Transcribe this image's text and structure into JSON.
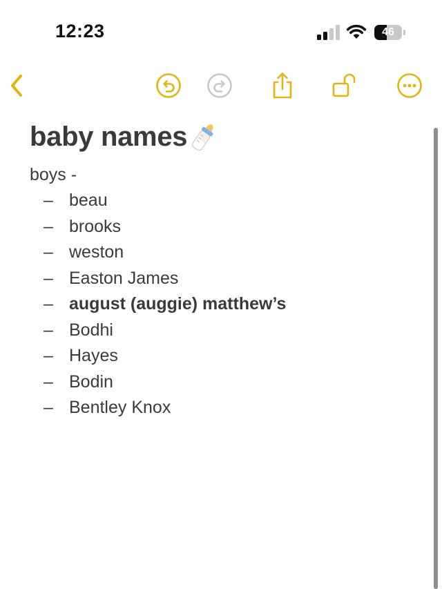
{
  "status_bar": {
    "time": "12:23",
    "battery_percent": 46,
    "battery_label": "46",
    "signal_bars_active": 2,
    "signal_bars_total": 4
  },
  "toolbar": {
    "accent_color": "#E3B40C",
    "disabled_color": "#C7C7CC",
    "icons": [
      "back-chevron-icon",
      "undo-icon",
      "redo-icon",
      "share-icon",
      "unlock-icon",
      "more-icon"
    ]
  },
  "note": {
    "title": "baby names",
    "title_emoji": "baby-bottle-icon",
    "section_label": "boys -",
    "items": [
      {
        "dash": "–",
        "text": "beau",
        "bold": false
      },
      {
        "dash": "–",
        "text": "brooks",
        "bold": false
      },
      {
        "dash": "–",
        "text": "weston",
        "bold": false
      },
      {
        "dash": "–",
        "text": "Easton James",
        "bold": false
      },
      {
        "dash": "–",
        "text": "august (auggie) matthew’s",
        "bold": true
      },
      {
        "dash": "–",
        "text": "Bodhi",
        "bold": false
      },
      {
        "dash": "–",
        "text": "Hayes",
        "bold": false
      },
      {
        "dash": "–",
        "text": "Bodin",
        "bold": false
      },
      {
        "dash": "–",
        "text": "Bentley Knox",
        "bold": false
      }
    ]
  }
}
